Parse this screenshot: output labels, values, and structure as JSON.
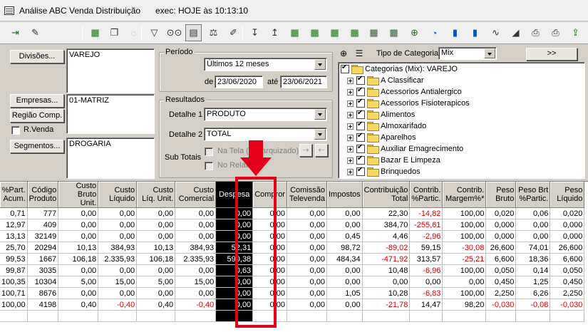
{
  "window": {
    "title": "Análise ABC Venda Distribuição",
    "exec_info": "exec: HOJE às 10:13:10"
  },
  "toolbar": {
    "icons": [
      "exit-icon",
      "eraser-icon",
      "blank-icon",
      "blank-icon",
      "spreadsheet-icon",
      "copy-icon",
      "disabled-icon",
      "filter-icon",
      "binoculars-icon",
      "calculator-icon",
      "scale-icon",
      "edit-icon",
      "sort-az-icon",
      "sort-za-icon",
      "grid-add-icon",
      "grid-remove-icon",
      "grid-check-icon",
      "grid-edit-icon",
      "grid-filter-icon",
      "grid-filter-2-icon",
      "zoom-icon",
      "pie-chart-icon",
      "bar-chart-icon",
      "bar-chart-2-icon",
      "line-chart-icon",
      "area-chart-icon",
      "print-icon",
      "print-preview-icon",
      "export-icon"
    ]
  },
  "filters": {
    "divisoes_label": "Divisões...",
    "divisoes_value": "VAREJO",
    "empresas_label": "Empresas...",
    "empresas_value": "01-MATRIZ",
    "regiao_label": "Região Comp.",
    "rvenda_label": "R.Venda",
    "segmentos_label": "Segmentos...",
    "segmentos_value": "DROGARIA"
  },
  "periodo": {
    "title": "Período",
    "selected": "Últimos 12 meses",
    "de_label": "de",
    "de_value": "23/06/2020",
    "ate_label": "até",
    "ate_value": "23/06/2021"
  },
  "resultados": {
    "title": "Resultados",
    "detalhe1_label": "Detalhe 1",
    "detalhe1_value": "PRODUTO",
    "detalhe2_label": "Detalhe 2",
    "detalhe2_value": "TOTAL",
    "subtotais_label": "Sub Totais",
    "na_tela_label": "Na Tela (hierarquizado)",
    "no_relat_label": "No Relatório"
  },
  "categorias": {
    "tipo_label": "Tipo de Categoria",
    "tipo_value": "Mix",
    "more_button": ">>",
    "root": "Categorias (Mix): VAREJO",
    "items": [
      " A Classificar",
      "Acessorios Antialergico",
      "Acessorios Fisioterapicos",
      "Alimentos",
      "Almoxarifado",
      "Aparelhos",
      "Auxiliar Emagrecimento",
      "Bazar E Limpeza",
      "Brinquedos"
    ]
  },
  "grid": {
    "columns": [
      "%Part.\nAcum.",
      "Código\nProduto",
      "Custo\nBruto Unit.",
      "Custo\nLíquido",
      "Custo\nLíq. Unit.",
      "Custo\nComercial",
      "Despesa",
      "Compror",
      "Comissão\nTelevenda",
      "Impostos",
      "Contribuição\nTotal",
      "Contrib.\n%Partic.",
      "Contrib.\nMargem%*",
      "Peso\nBruto",
      "Peso Brt\n%Partic.",
      "Peso\nLíquido"
    ],
    "rows": [
      [
        "0,71",
        "777",
        "0,00",
        "0,00",
        "0,00",
        "0,00",
        "0,00",
        "0,00",
        "0,00",
        "0,00",
        "22,30",
        "-14,82",
        "100,00",
        "0,020",
        "0,06",
        "0,020"
      ],
      [
        "12,97",
        "409",
        "0,00",
        "0,00",
        "0,00",
        "0,00",
        "0,00",
        "0,00",
        "0,00",
        "0,00",
        "384,70",
        "-255,61",
        "100,00",
        "0,000",
        "0,00",
        "0,000"
      ],
      [
        "13,13",
        "32149",
        "0,00",
        "0,00",
        "0,00",
        "0,00",
        "0,00",
        "0,00",
        "0,00",
        "0,45",
        "4,46",
        "-2,96",
        "100,00",
        "0,000",
        "0,00",
        "0,000"
      ],
      [
        "25,70",
        "20294",
        "10,13",
        "384,93",
        "10,13",
        "384,93",
        "52,31",
        "0,00",
        "0,00",
        "98,72",
        "-89,02",
        "59,15",
        "-30,08",
        "26,600",
        "74,01",
        "26,600"
      ],
      [
        "99,53",
        "1667",
        "106,18",
        "2.335,93",
        "106,18",
        "2.335,93",
        "590,38",
        "0,00",
        "0,00",
        "484,34",
        "-471,92",
        "313,57",
        "-25,21",
        "6,600",
        "18,36",
        "6,600"
      ],
      [
        "99,87",
        "3035",
        "0,00",
        "0,00",
        "0,00",
        "0,00",
        "0,63",
        "0,00",
        "0,00",
        "0,00",
        "10,48",
        "-6,96",
        "100,00",
        "0,050",
        "0,14",
        "0,050"
      ],
      [
        "100,35",
        "10304",
        "5,00",
        "15,00",
        "5,00",
        "15,00",
        "0,00",
        "0,00",
        "0,00",
        "0,00",
        "0,00",
        "0,00",
        "0,00",
        "0,450",
        "1,25",
        "0,450"
      ],
      [
        "100,71",
        "8676",
        "0,00",
        "0,00",
        "0,00",
        "0,00",
        "0,00",
        "0,00",
        "0,00",
        "1,05",
        "10,28",
        "-6,83",
        "100,00",
        "2,250",
        "6,26",
        "2,250"
      ],
      [
        "100,00",
        "4198",
        "0,40",
        "-0,40",
        "0,40",
        "-0,40",
        "0,00",
        "0,00",
        "0,00",
        "0,00",
        "-21,78",
        "14,47",
        "98,20",
        "-0,030",
        "-0,08",
        "-0,030"
      ]
    ],
    "highlight_column": "Despesa"
  },
  "colors": {
    "negative": "#e00000",
    "highlight_bg": "#000000",
    "annotation": "#e3001b"
  }
}
